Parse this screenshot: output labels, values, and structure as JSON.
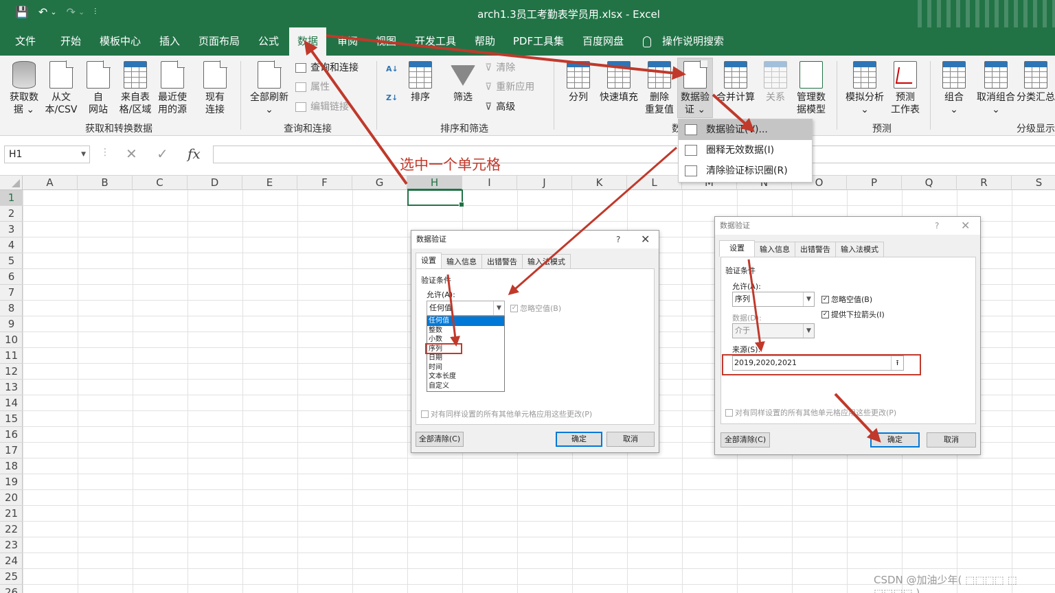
{
  "titlebar": {
    "file_title": "arch1.3员工考勤表学员用.xlsx  -  Excel",
    "qat": {
      "save": "💾",
      "undo": "↶",
      "undo_dd": "⌄",
      "redo": "↷",
      "redo_dd": "⌄",
      "customize": "⫶"
    }
  },
  "tabs": [
    "文件",
    "开始",
    "模板中心",
    "插入",
    "页面布局",
    "公式",
    "数据",
    "审阅",
    "视图",
    "开发工具",
    "帮助",
    "PDF工具集",
    "百度网盘"
  ],
  "tell_me": {
    "icon": "lightbulb-icon",
    "label": "操作说明搜索"
  },
  "ribbon": {
    "get_transform": {
      "buttons": [
        "获取数\n据 ⌄",
        "从文\n本/CSV",
        "自\n网站",
        "来自表\n格/区域",
        "最近使\n用的源",
        "现有\n连接"
      ],
      "label": "获取和转换数据"
    },
    "queries": {
      "refresh_all": "全部刷新\n⌄",
      "small": [
        "查询和连接",
        "属性",
        "编辑链接"
      ],
      "label": "查询和连接"
    },
    "sort_filter": {
      "sort": "排序",
      "filter": "筛选",
      "small": [
        "清除",
        "重新应用",
        "高级"
      ],
      "label": "排序和筛选"
    },
    "data_tools": {
      "buttons": [
        "分列",
        "快速填充",
        "删除\n重复值",
        "数据验\n证 ⌄",
        "合并计算",
        "关系",
        "管理数\n据模型"
      ],
      "label": "数"
    },
    "forecast": {
      "buttons": [
        "模拟分析\n⌄",
        "预测\n工作表"
      ],
      "label": "预测"
    },
    "outline": {
      "buttons": [
        "组合\n⌄",
        "取消组合\n⌄",
        "分类汇总"
      ],
      "label": "分级显示"
    }
  },
  "dv_menu": [
    "数据验证(V)...",
    "圈释无效数据(I)",
    "清除验证标识圈(R)"
  ],
  "formula_bar": {
    "name_box": "H1",
    "cancel": "✕",
    "enter": "✓",
    "fx": "fx",
    "value": ""
  },
  "columns": [
    "A",
    "B",
    "C",
    "D",
    "E",
    "F",
    "G",
    "H",
    "I",
    "J",
    "K",
    "L",
    "M",
    "N",
    "O",
    "P",
    "Q",
    "R",
    "S"
  ],
  "rows": [
    "1",
    "2",
    "3",
    "4",
    "5",
    "6",
    "7",
    "8",
    "9",
    "10",
    "11",
    "12",
    "13",
    "14",
    "15",
    "16",
    "17",
    "18",
    "19",
    "20",
    "21",
    "22",
    "23",
    "24",
    "25",
    "26"
  ],
  "annotation": "选中一个单元格",
  "dialog1": {
    "title": "数据验证",
    "help": "?",
    "close": "✕",
    "tabs": [
      "设置",
      "输入信息",
      "出错警告",
      "输入法模式"
    ],
    "section": "验证条件",
    "allow_label": "允许(A):",
    "allow_value": "任何值",
    "ignore_blank": "忽略空值(B)",
    "list_options": [
      "任何值",
      "整数",
      "小数",
      "序列",
      "日期",
      "时间",
      "文本长度",
      "自定义"
    ],
    "apply_all": "对有同样设置的所有其他单元格应用这些更改(P)",
    "clear_all": "全部清除(C)",
    "ok": "确定",
    "cancel": "取消"
  },
  "dialog2": {
    "title": "数据验证",
    "help": "?",
    "close": "✕",
    "tabs": [
      "设置",
      "输入信息",
      "出错警告",
      "输入法模式"
    ],
    "section": "验证条件",
    "allow_label": "允许(A):",
    "allow_value": "序列",
    "ignore_blank": "忽略空值(B)",
    "dropdown_arrow": "提供下拉箭头(I)",
    "data_label": "数据(D):",
    "data_value": "介于",
    "source_label": "来源(S):",
    "source_value": "2019,2020,2021",
    "apply_all": "对有同样设置的所有其他单元格应用这些更改(P)",
    "clear_all": "全部清除(C)",
    "ok": "确定",
    "cancel": "取消"
  },
  "watermark": "CSDN @加油少年( ⬚⬚⬚⬚ ⬚ ⬚⬚⬚⬚ )",
  "colors": {
    "excel_green": "#217346",
    "annotation_red": "#c0392b"
  }
}
